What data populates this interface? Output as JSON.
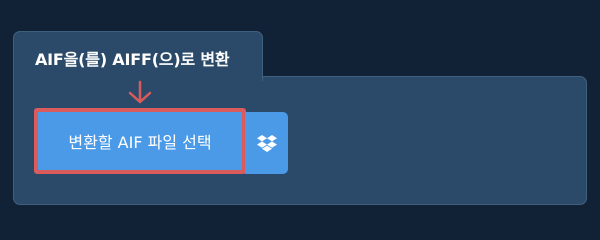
{
  "tab": {
    "title": "AIF을(를) AIFF(으)로 변환"
  },
  "upload": {
    "select_label": "변환할 AIF 파일 선택",
    "dropbox_icon": "dropbox-icon"
  },
  "colors": {
    "background": "#112236",
    "panel": "#2b4a69",
    "button": "#4a9ae8",
    "highlight": "#d95b5b"
  }
}
